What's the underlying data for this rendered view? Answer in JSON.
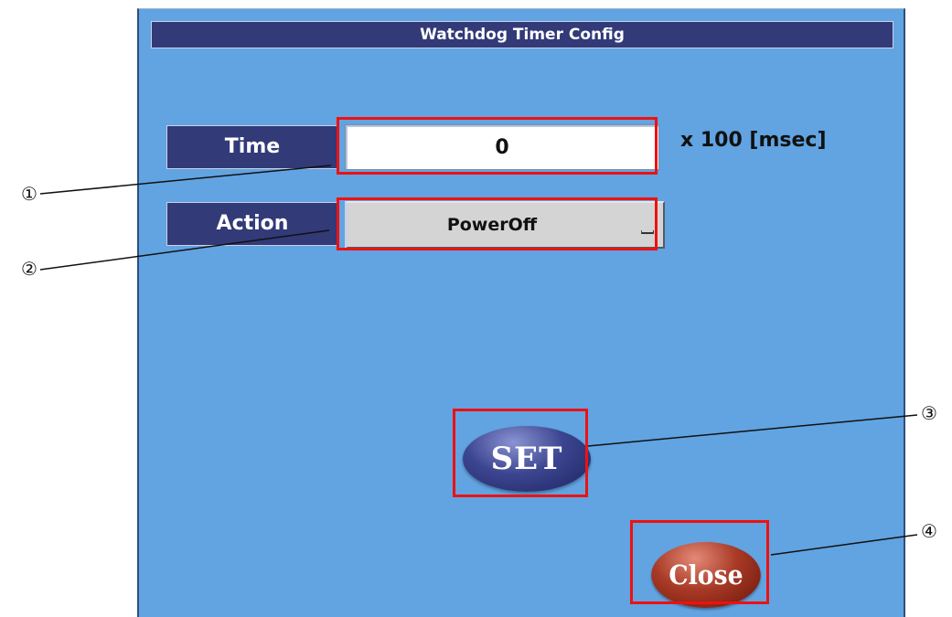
{
  "window": {
    "title": "Watchdog Timer Config"
  },
  "time_row": {
    "label": "Time",
    "value": "0",
    "unit": "x 100 [msec]"
  },
  "action_row": {
    "label": "Action",
    "selected": "PowerOff"
  },
  "buttons": {
    "set_label": "SET",
    "close_label": "Close"
  },
  "callouts": {
    "c1": "①",
    "c2": "②",
    "c3": "③",
    "c4": "④"
  },
  "colors": {
    "window_background": "#62a3e1",
    "header_background": "#323a78",
    "highlight": "#ee1111",
    "set_button": "#3c4590",
    "close_button": "#a83a26"
  },
  "icons": {
    "dropdown": "dropdown-indicator-icon"
  }
}
